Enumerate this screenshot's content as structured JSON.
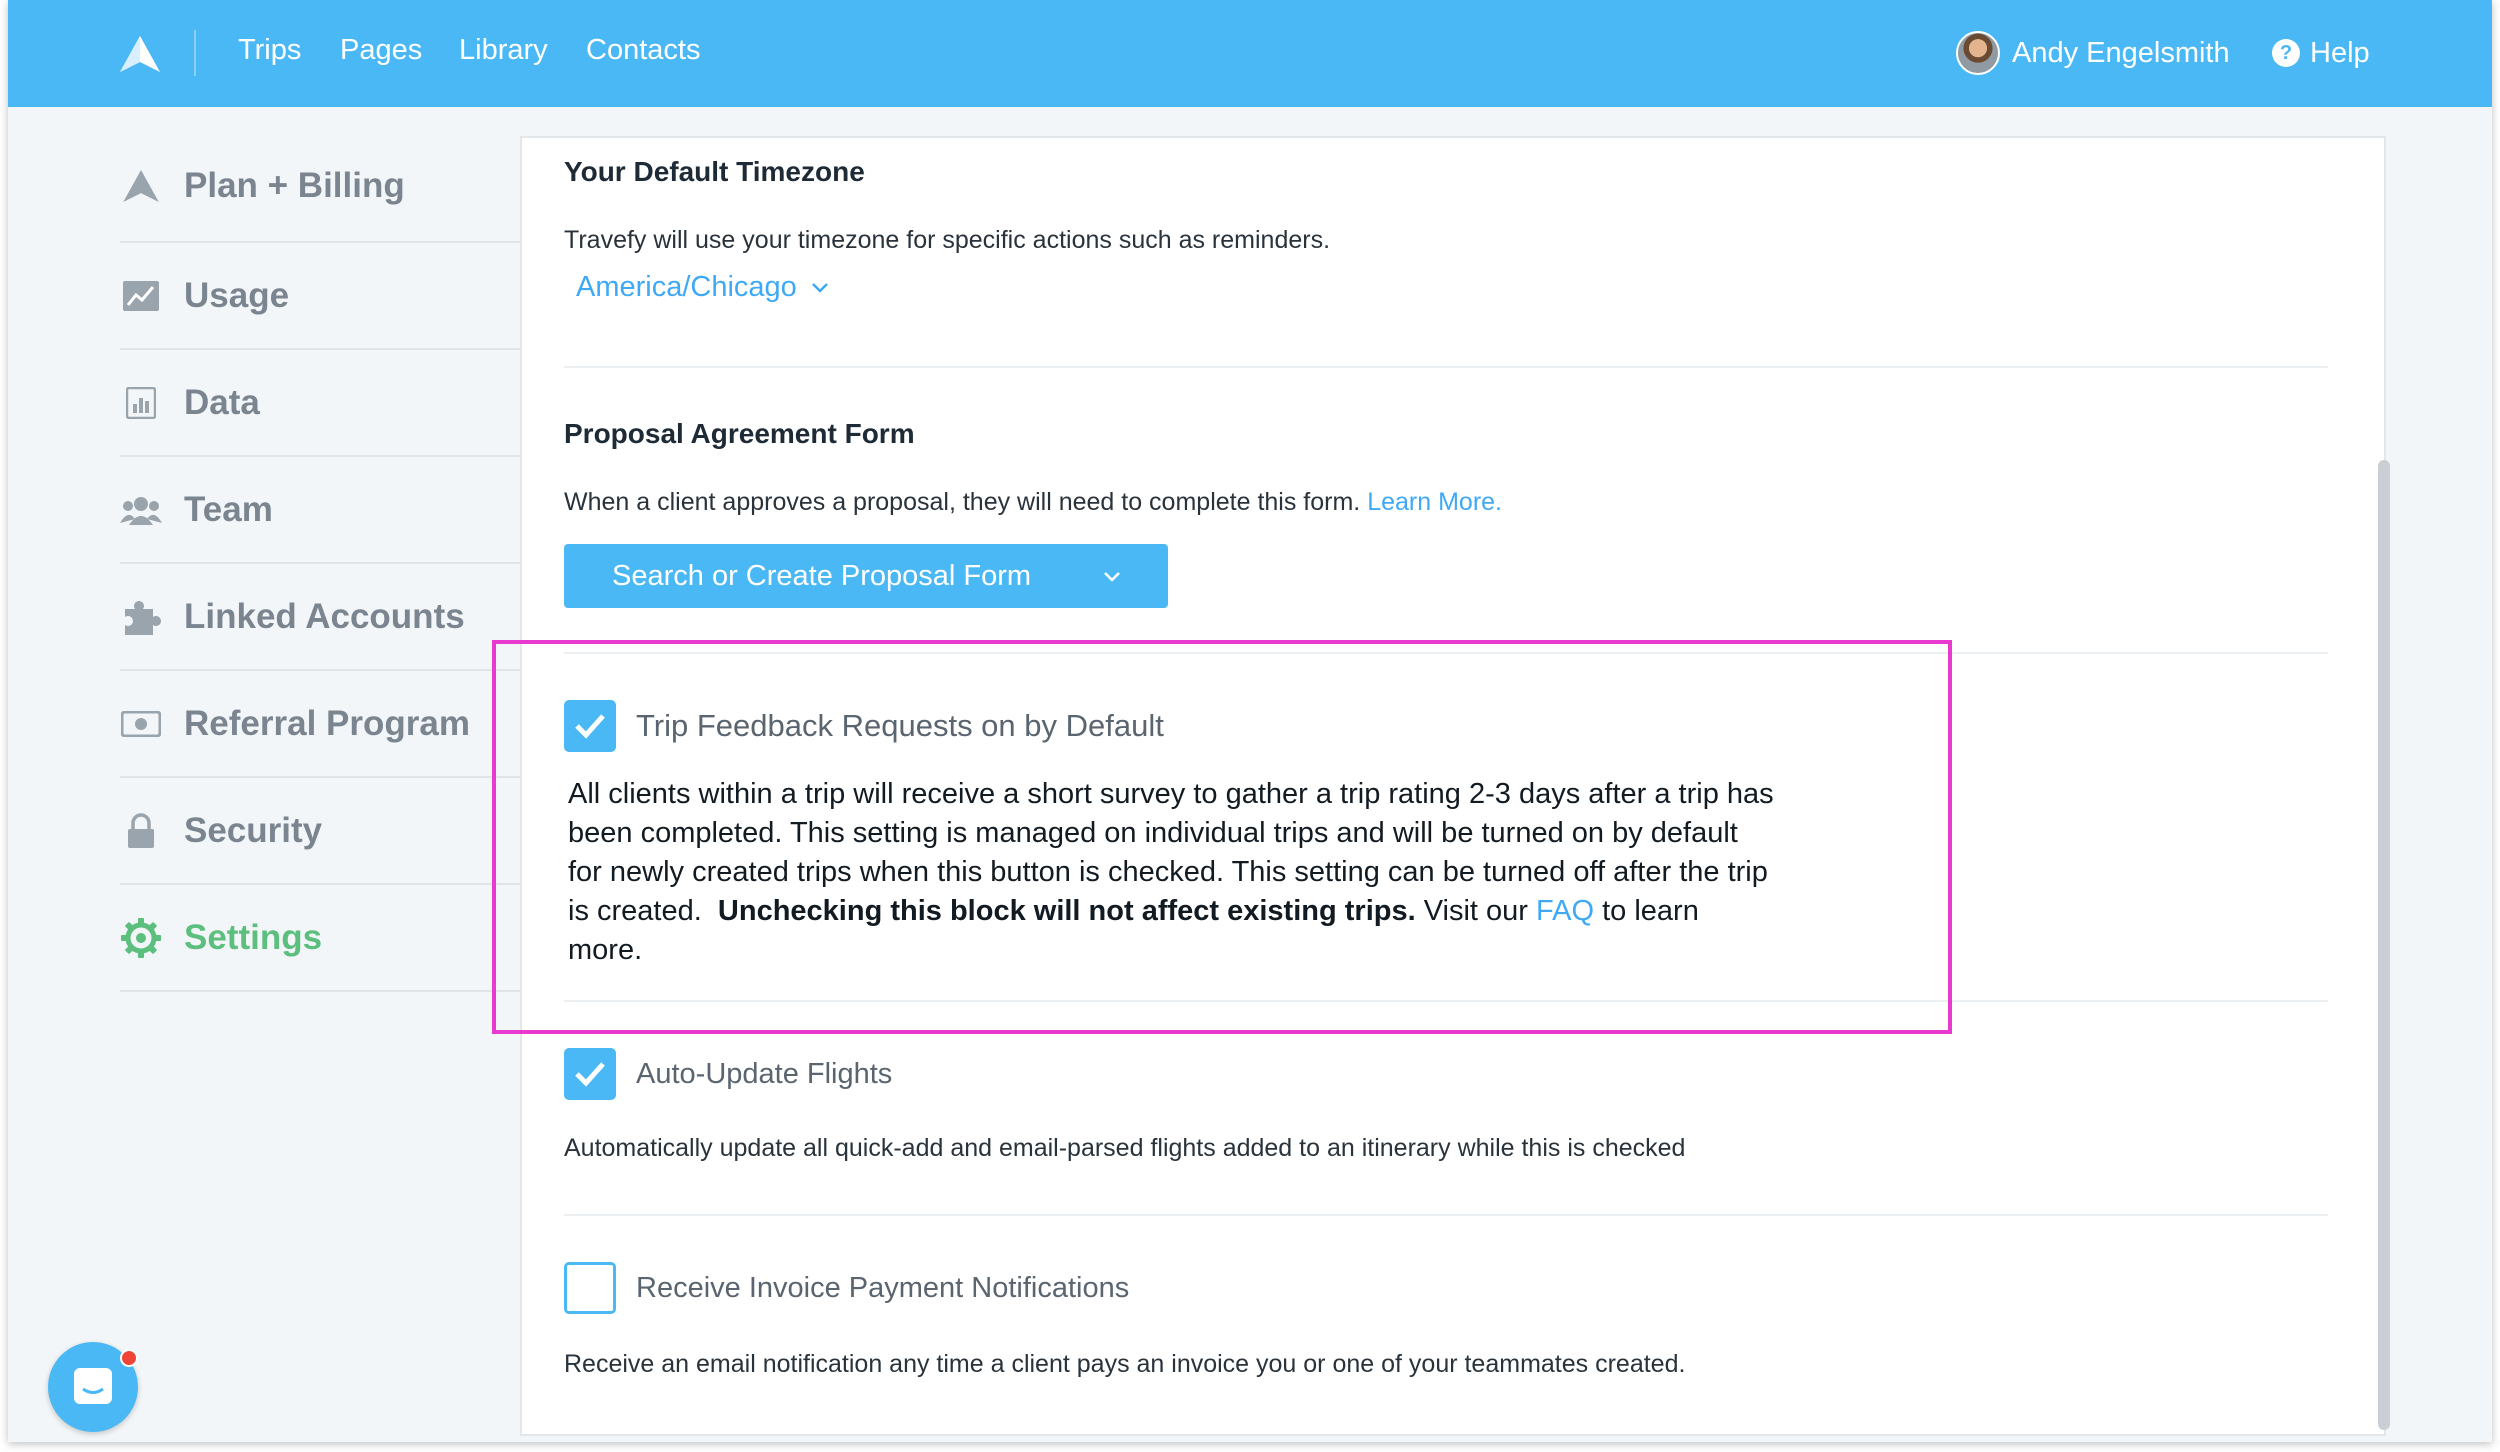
{
  "nav": {
    "links": [
      "Trips",
      "Pages",
      "Library",
      "Contacts"
    ],
    "user_name": "Andy Engelsmith",
    "help_label": "Help"
  },
  "sidebar": {
    "items": [
      {
        "label": "Plan + Billing",
        "icon": "logo-icon"
      },
      {
        "label": "Usage",
        "icon": "chart-icon"
      },
      {
        "label": "Data",
        "icon": "data-icon"
      },
      {
        "label": "Team",
        "icon": "team-icon"
      },
      {
        "label": "Linked Accounts",
        "icon": "puzzle-icon"
      },
      {
        "label": "Referral Program",
        "icon": "money-icon"
      },
      {
        "label": "Security",
        "icon": "lock-icon"
      },
      {
        "label": "Settings",
        "icon": "gear-icon",
        "active": true
      }
    ]
  },
  "timezone": {
    "title": "Your Default Timezone",
    "description": "Travefy will use your timezone for specific actions such as reminders.",
    "value": "America/Chicago"
  },
  "proposal": {
    "title": "Proposal Agreement Form",
    "description": "When a client approves a proposal, they will need to complete this form.",
    "learn_more": "Learn More.",
    "button_label": "Search or Create Proposal Form"
  },
  "feedback": {
    "label": "Trip Feedback Requests on by Default",
    "checked": true,
    "text_1": "All clients within a trip will receive a short survey to gather a trip rating 2-3 days after a trip has been completed.  This setting is managed on individual trips and will be turned on by default for newly created trips when this button is checked.  This setting can be turned off after the trip is created.",
    "text_bold": "Unchecking this block will not affect existing trips.",
    "text_2": "Visit our",
    "faq": "FAQ",
    "text_3": "to learn more."
  },
  "flights": {
    "label": "Auto-Update Flights",
    "checked": true,
    "description": "Automatically update all quick-add and email-parsed flights added to an itinerary while this is checked"
  },
  "invoice": {
    "label": "Receive Invoice Payment Notifications",
    "checked": false,
    "description": "Receive an email notification any time a client pays an invoice you or one of your teammates created."
  },
  "colors": {
    "brand": "#4bb8f6",
    "active": "#5cbf7e",
    "highlight": "#e93ad0"
  }
}
